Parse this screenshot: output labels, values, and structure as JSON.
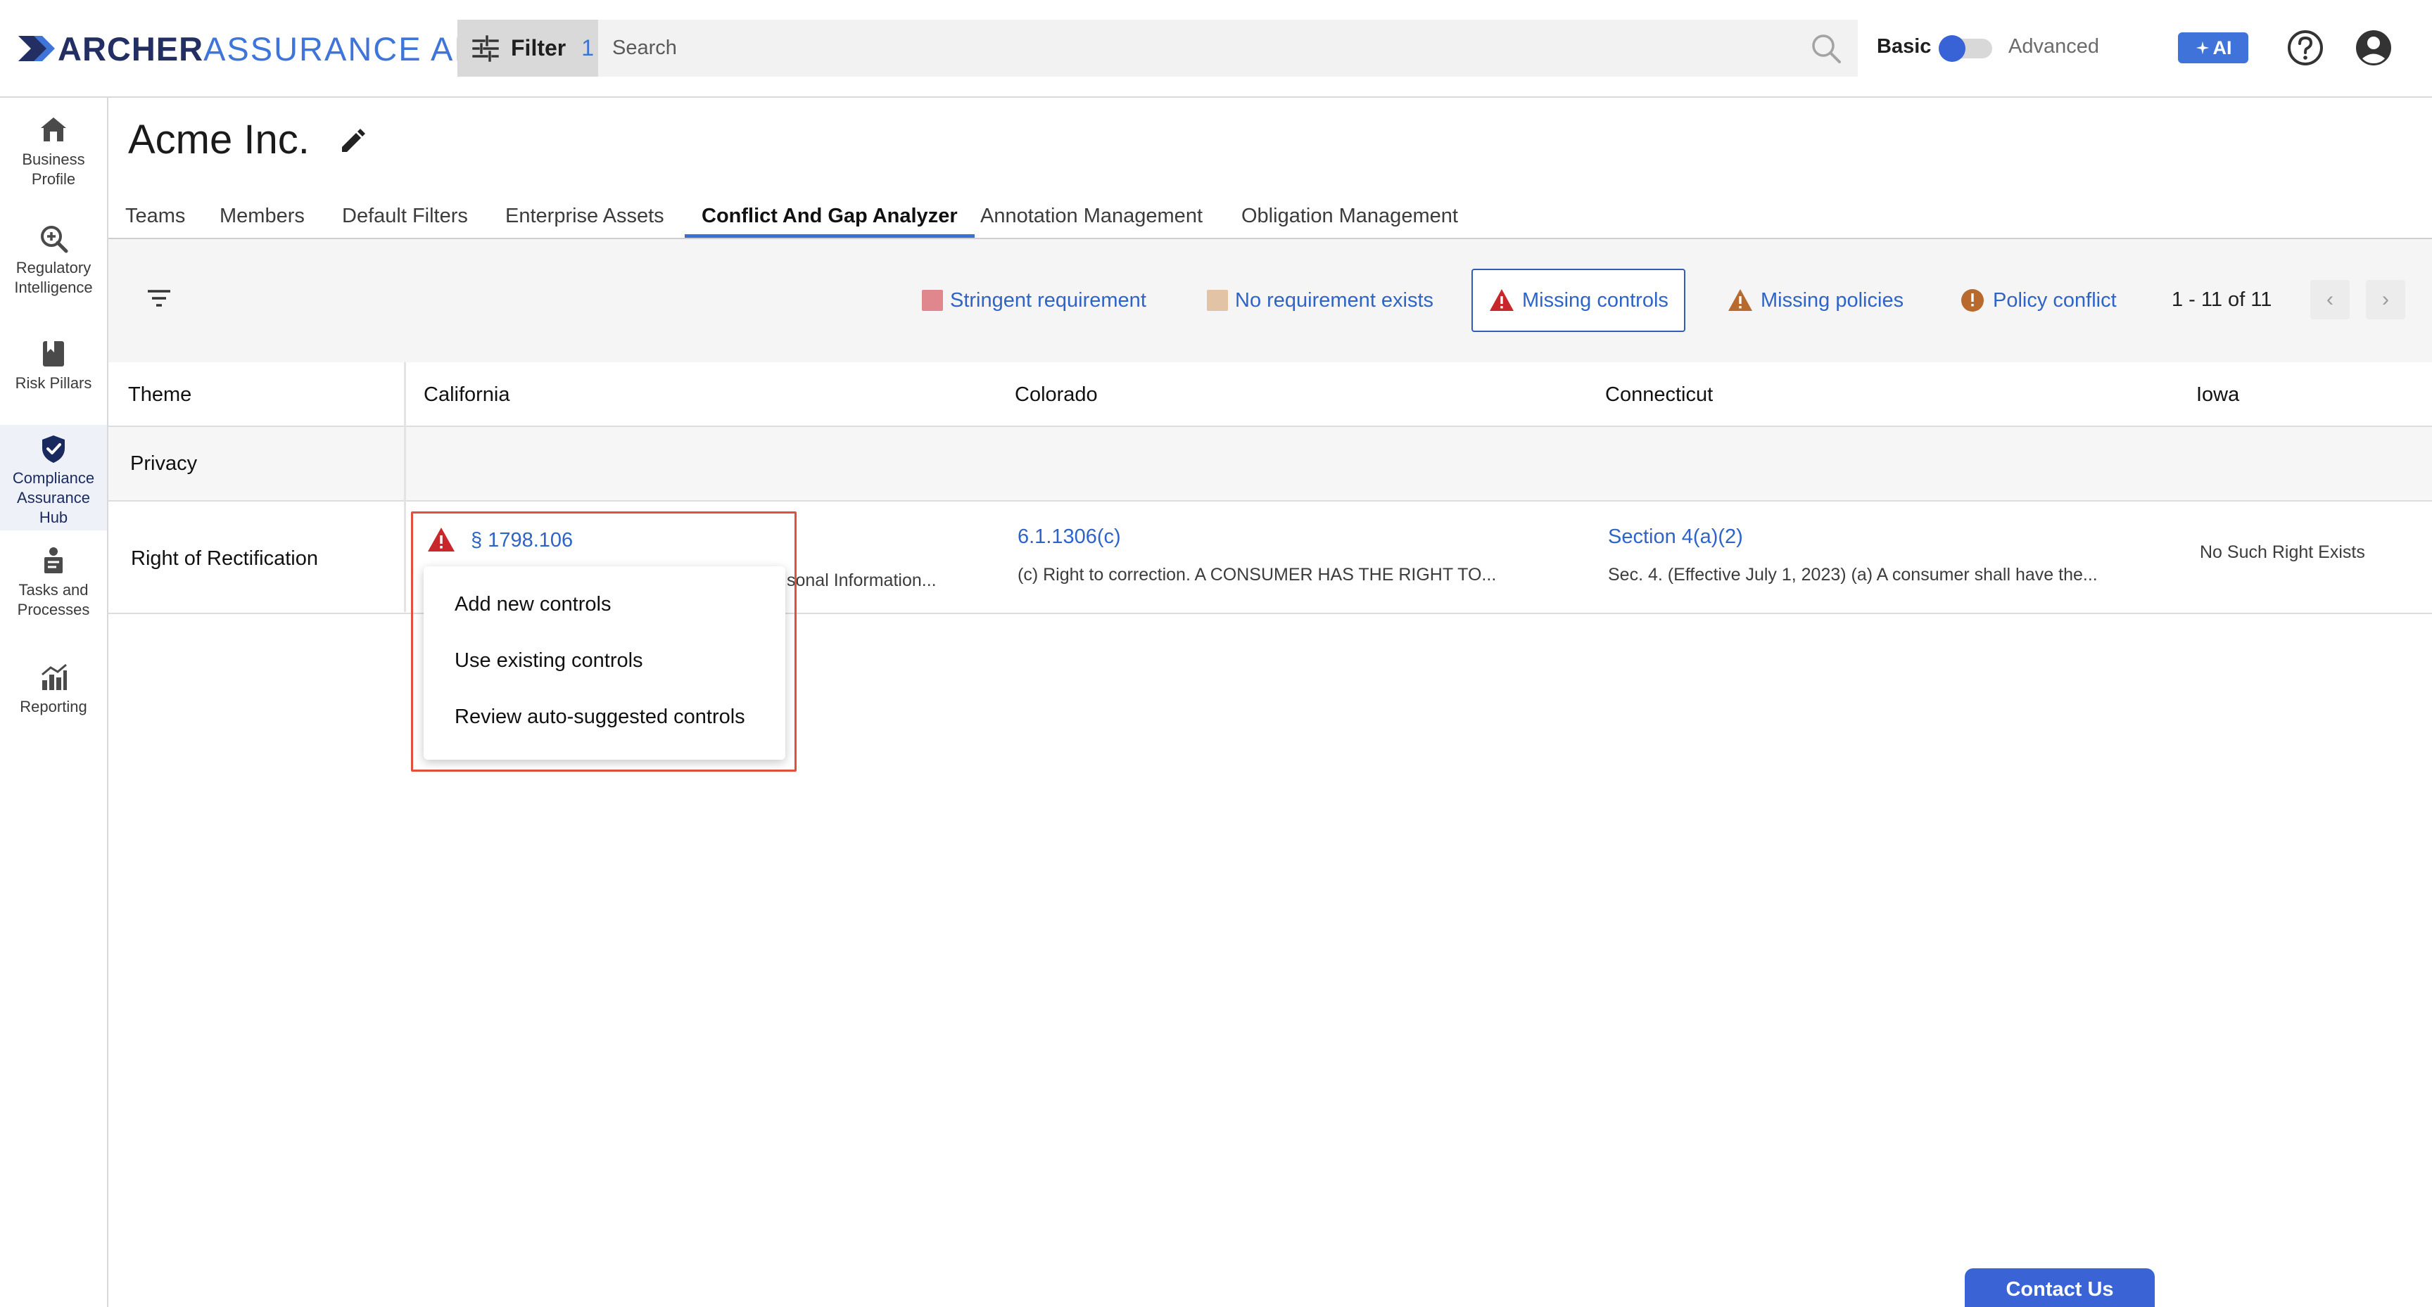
{
  "brand": {
    "part1": "ARCHER",
    "part2": "ASSURANCE AI"
  },
  "topbar": {
    "filter_label": "Filter",
    "filter_count": "1",
    "search_placeholder": "Search",
    "mode_basic": "Basic",
    "mode_advanced": "Advanced",
    "ai_label": "AI"
  },
  "sidebar": {
    "items": [
      {
        "label1": "Business",
        "label2": "Profile",
        "icon": "home-icon"
      },
      {
        "label1": "Regulatory",
        "label2": "Intelligence",
        "icon": "search-zoom-icon"
      },
      {
        "label1": "Risk Pillars",
        "label2": "",
        "icon": "book-icon"
      },
      {
        "label1": "Compliance",
        "label2": "Assurance",
        "label3": "Hub",
        "icon": "shield-check-icon"
      },
      {
        "label1": "Tasks and",
        "label2": "Processes",
        "icon": "tasks-icon"
      },
      {
        "label1": "Reporting",
        "label2": "",
        "icon": "chart-icon"
      }
    ]
  },
  "page": {
    "title": "Acme Inc."
  },
  "tabs": [
    "Teams",
    "Members",
    "Default Filters",
    "Enterprise Assets",
    "Conflict And Gap Analyzer",
    "Annotation Management",
    "Obligation Management"
  ],
  "legend": {
    "stringent": "Stringent requirement",
    "no_req": "No requirement exists",
    "missing_controls": "Missing controls",
    "missing_policies": "Missing policies",
    "policy_conflict": "Policy conflict",
    "pager": "1 - 11 of 11",
    "colors": {
      "stringent": "#e0868d",
      "no_req": "#e3c3a5",
      "missing_controls": "#c8282b",
      "missing_policies": "#b8692e",
      "policy_conflict": "#b8692e"
    }
  },
  "grid": {
    "headers": [
      "Theme",
      "California",
      "Colorado",
      "Connecticut",
      "Iowa"
    ],
    "group": "Privacy",
    "row": {
      "theme": "Right of Rectification",
      "california": {
        "link": "§ 1798.106",
        "desc_tail": "sonal Information..."
      },
      "colorado": {
        "link": "6.1.1306(c)",
        "desc": "(c) Right to correction. A CONSUMER HAS THE RIGHT TO..."
      },
      "connecticut": {
        "link": "Section 4(a)(2)",
        "desc": "Sec. 4. (Effective July 1, 2023) (a) A consumer shall have the..."
      },
      "iowa": "No Such Right Exists"
    }
  },
  "popup": {
    "options": [
      "Add new controls",
      "Use existing controls",
      "Review auto-suggested controls"
    ]
  },
  "contact": "Contact Us"
}
